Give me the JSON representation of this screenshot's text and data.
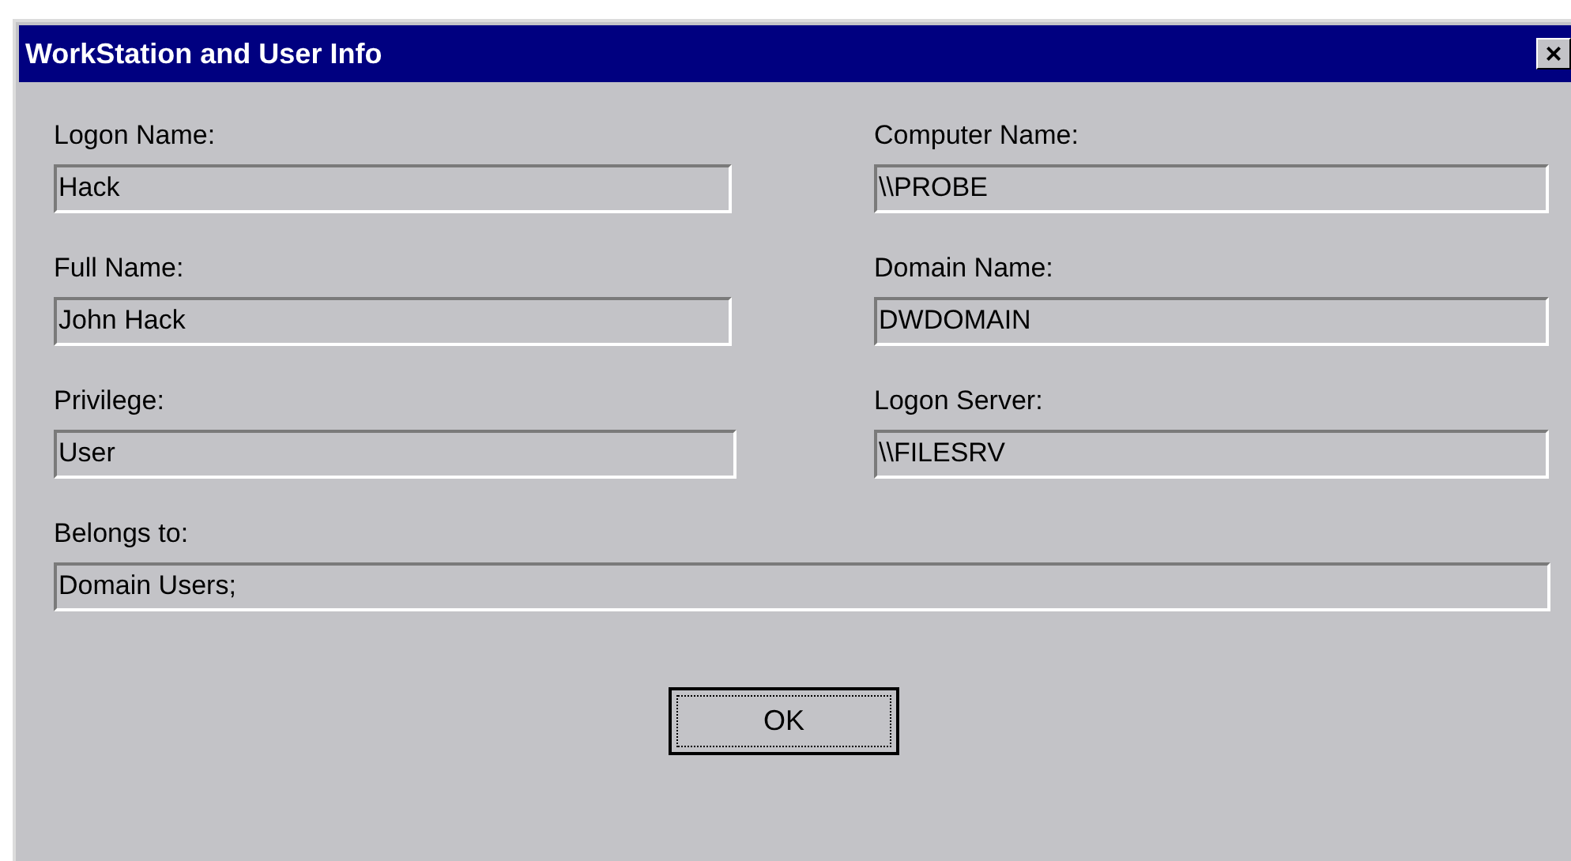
{
  "window": {
    "title": "WorkStation and User Info",
    "close": "×"
  },
  "fields": [
    {
      "label": "Logon Name:",
      "value": "Hack"
    },
    {
      "label": "Computer Name:",
      "value": "\\\\PROBE"
    },
    {
      "label": "Full Name:",
      "value": "John Hack"
    },
    {
      "label": "Domain Name:",
      "value": "DWDOMAIN"
    },
    {
      "label": "Privilege:",
      "value": "User"
    },
    {
      "label": "Logon Server:",
      "value": "\\\\FILESRV"
    }
  ],
  "belongs_to": {
    "label": "Belongs to:",
    "value": "Domain Users;"
  },
  "buttons": [
    {
      "label": "OK",
      "focused": true
    }
  ]
}
